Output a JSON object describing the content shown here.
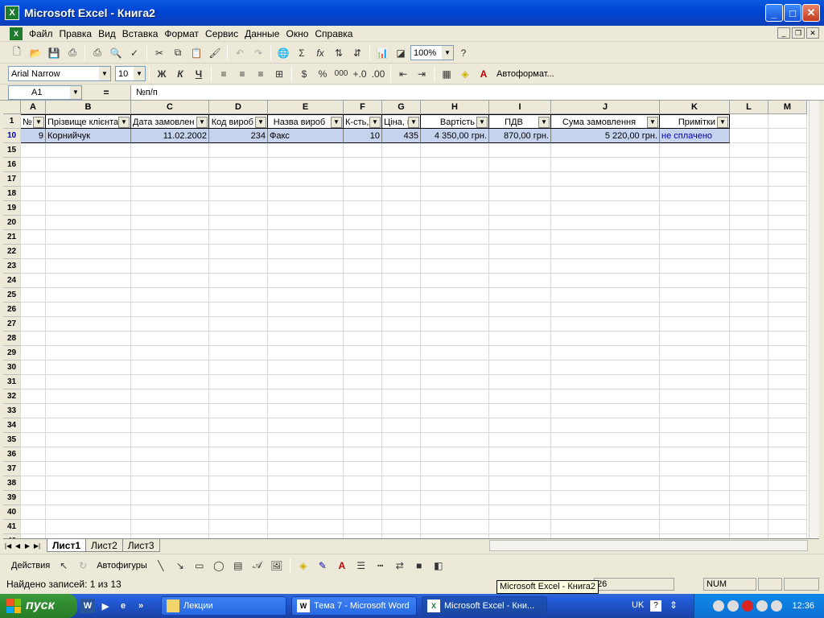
{
  "window": {
    "title": "Microsoft Excel - Книга2"
  },
  "menu": [
    "Файл",
    "Правка",
    "Вид",
    "Вставка",
    "Формат",
    "Сервис",
    "Данные",
    "Окно",
    "Справка"
  ],
  "toolbar": {
    "zoom": "100%",
    "font_name": "Arial Narrow",
    "font_size": "10",
    "bold": "Ж",
    "italic": "К",
    "underline": "Ч",
    "autoformat": "Автоформат...",
    "sum": "Σ",
    "fx": "fx",
    "percent": "%",
    "thousands": "000"
  },
  "formula_bar": {
    "name_box": "A1",
    "equals": "=",
    "content": "№п/п"
  },
  "columns": [
    "A",
    "B",
    "C",
    "D",
    "E",
    "F",
    "G",
    "H",
    "I",
    "J",
    "K",
    "L",
    "M"
  ],
  "rows": [
    "1",
    "10",
    "15",
    "16",
    "17",
    "18",
    "19",
    "20",
    "21",
    "22",
    "23",
    "24",
    "25",
    "26",
    "27",
    "28",
    "29",
    "30",
    "31",
    "32",
    "33",
    "34",
    "35",
    "36",
    "37",
    "38",
    "39",
    "40",
    "41",
    "42"
  ],
  "headers": [
    "№",
    "Прізвище клієнта",
    "Дата замовлен",
    "Код вироб",
    "Назва вироб",
    "К-сть,",
    "Ціна, г",
    "Вартість",
    "ПДВ",
    "Сума замовлення",
    "Примітки"
  ],
  "data_row": [
    "9",
    "Корнийчук",
    "11.02.2002",
    "234",
    "Факс",
    "10",
    "435",
    "4 350,00 грн.",
    "870,00 грн.",
    "5 220,00 грн.",
    "не сплачено"
  ],
  "sheets": [
    "Лист1",
    "Лист2",
    "Лист3"
  ],
  "drawing": {
    "actions": "Действия",
    "autoshapes": "Автофигуры"
  },
  "status": {
    "text": "Найдено записей: 1 из 13",
    "num": "NUM",
    "partial": "26"
  },
  "tooltip": "Microsoft Excel - Книга2",
  "taskbar": {
    "start": "пуск",
    "tasks": [
      "Лекции",
      "Тема 7 - Microsoft Word",
      "Microsoft Excel - Кни..."
    ],
    "lang": "UK",
    "time": "12:36"
  }
}
